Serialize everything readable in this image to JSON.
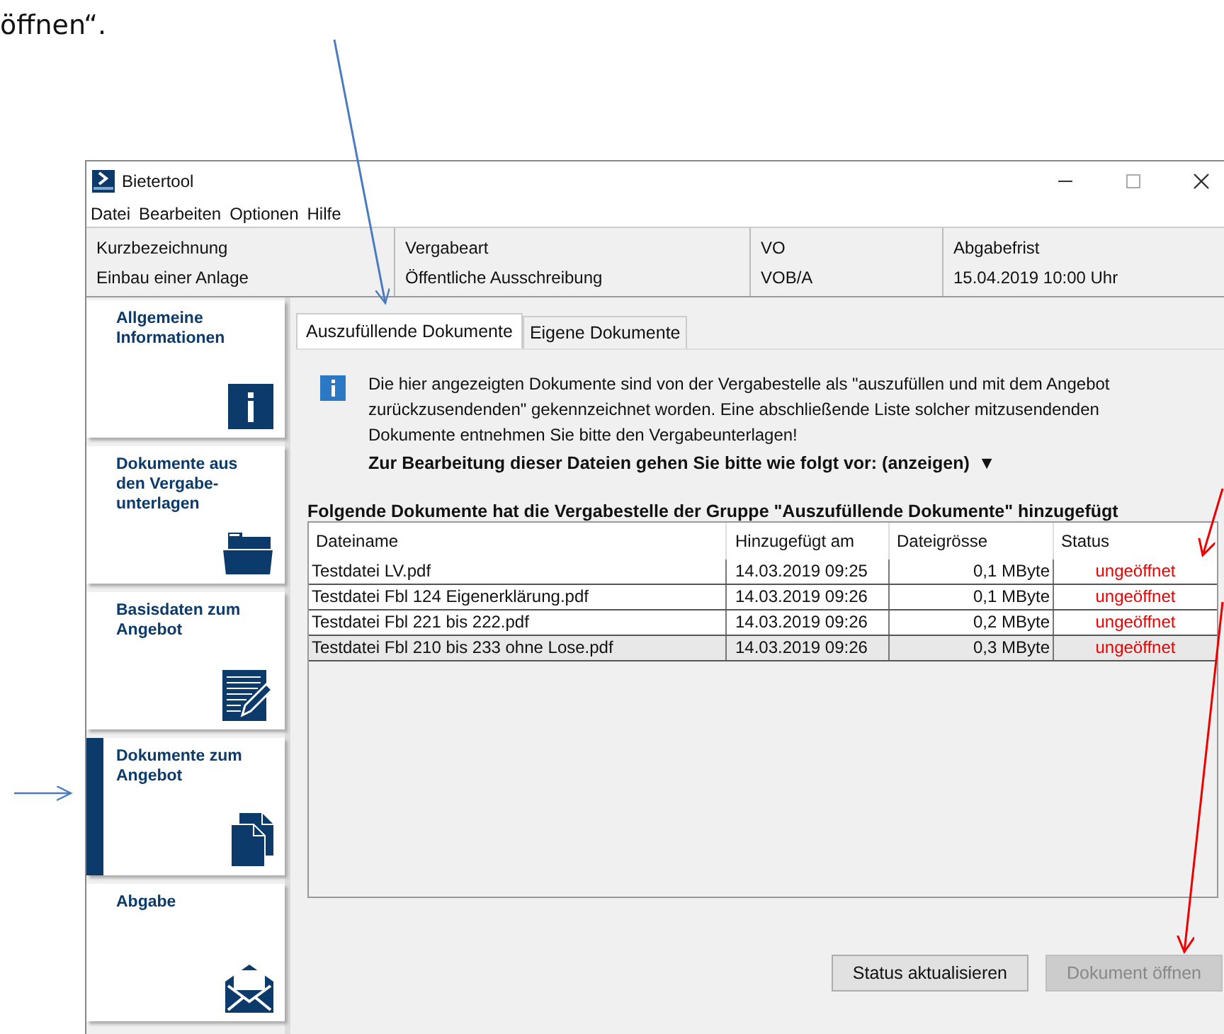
{
  "document_text": "öffnen“.",
  "window": {
    "title": "Bietertool"
  },
  "menu": [
    "Datei",
    "Bearbeiten",
    "Optionen",
    "Hilfe"
  ],
  "header": [
    {
      "label": "Kurzbezeichnung",
      "value": "Einbau einer Anlage"
    },
    {
      "label": "Vergabeart",
      "value": "Öffentliche Ausschreibung"
    },
    {
      "label": "VO",
      "value": "VOB/A"
    },
    {
      "label": "Abgabefrist",
      "value": "15.04.2019 10:00 Uhr"
    }
  ],
  "sidebar": {
    "items": [
      {
        "label": "Allgemeine Informationen",
        "kind": "info",
        "selected": false
      },
      {
        "label": "Dokumente aus den Vergabe-unterlagen",
        "kind": "folder",
        "selected": false
      },
      {
        "label": "Basisdaten zum Angebot",
        "kind": "form",
        "selected": false
      },
      {
        "label": "Dokumente zum Angebot",
        "kind": "documents",
        "selected": true
      },
      {
        "label": "Abgabe",
        "kind": "envelope",
        "selected": false
      }
    ]
  },
  "tabs": [
    {
      "label": "Auszufüllende Dokumente",
      "selected": true
    },
    {
      "label": "Eigene Dokumente",
      "selected": false
    }
  ],
  "info": {
    "text": "Die hier angezeigten Dokumente sind von der Vergabestelle als \"auszufüllen und mit dem Angebot zurückzusendenden\" gekennzeichnet worden. Eine abschließende Liste solcher mitzusendenden Dokumente entnehmen Sie bitte den Vergabeunterlagen!",
    "instruction": "Zur Bearbeitung dieser Dateien gehen Sie bitte wie folgt vor: (anzeigen)",
    "toggle": "▼"
  },
  "table": {
    "title": "Folgende Dokumente hat die Vergabestelle der Gruppe \"Auszufüllende Dokumente\" hinzugefügt",
    "columns": [
      "Dateiname",
      "Hinzugefügt am",
      "Dateigrösse",
      "Status"
    ],
    "rows": [
      {
        "cells": [
          "Testdatei LV.pdf",
          "14.03.2019 09:25",
          "0,1 MByte",
          "ungeöffnet"
        ],
        "selected": false
      },
      {
        "cells": [
          "Testdatei Fbl 124 Eigenerklärung.pdf",
          "14.03.2019 09:26",
          "0,1 MByte",
          "ungeöffnet"
        ],
        "selected": false
      },
      {
        "cells": [
          "Testdatei Fbl 221 bis 222.pdf",
          "14.03.2019 09:26",
          "0,2 MByte",
          "ungeöffnet"
        ],
        "selected": false
      },
      {
        "cells": [
          "Testdatei Fbl 210 bis 233 ohne Lose.pdf",
          "14.03.2019 09:26",
          "0,3 MByte",
          "ungeöffnet"
        ],
        "selected": true
      }
    ]
  },
  "buttons": [
    {
      "label": "Status aktualisieren",
      "disabled": false
    },
    {
      "label": "Dokument öffnen",
      "disabled": true
    }
  ]
}
